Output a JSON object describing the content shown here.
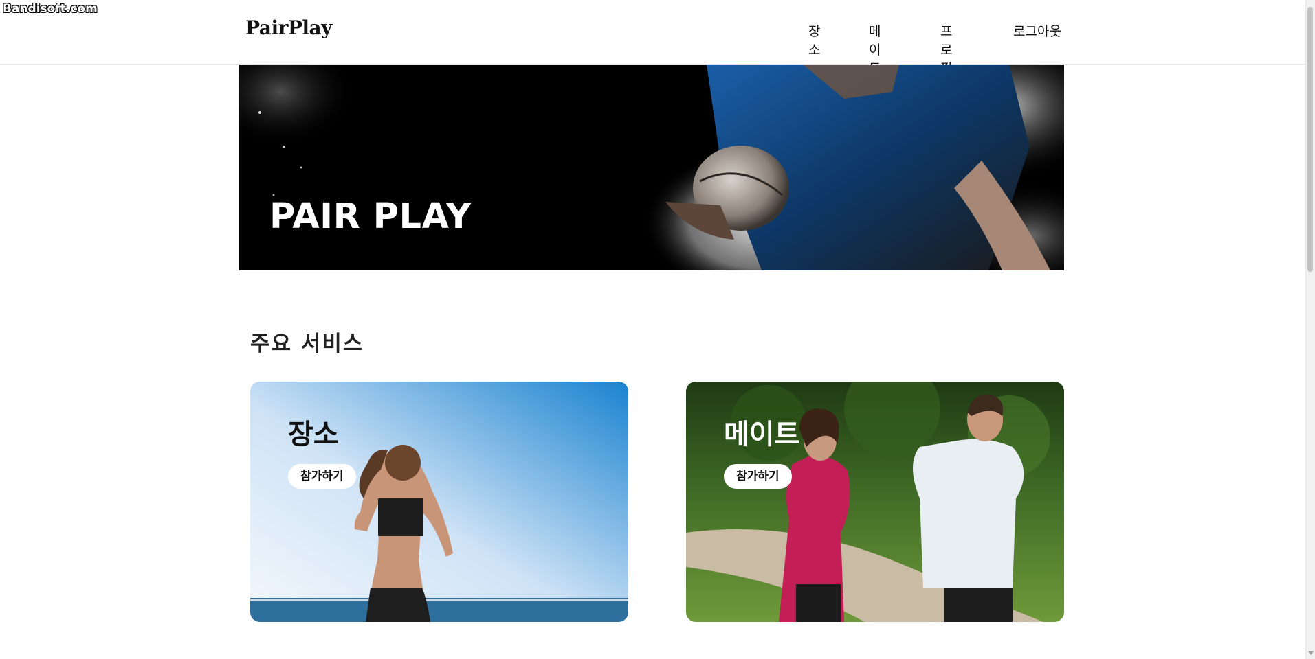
{
  "watermark": "Bandisoft.com",
  "header": {
    "logo": "PairPlay",
    "nav": [
      "장소",
      "메이트",
      "프로필",
      "로그아웃"
    ]
  },
  "hero": {
    "title": "PAIR PLAY"
  },
  "services": {
    "title": "주요 서비스",
    "cards": [
      {
        "title": "장소",
        "button": "참가하기"
      },
      {
        "title": "메이트",
        "button": "참가하기"
      }
    ]
  }
}
